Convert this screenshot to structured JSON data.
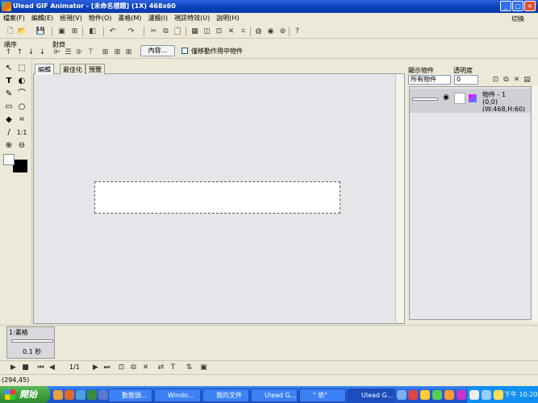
{
  "window": {
    "title": "Ulead GIF Animator - [未命名標題] (1X) 468x60",
    "min": "_",
    "max": "□",
    "close": "×"
  },
  "menu": {
    "items": [
      "檔案(F)",
      "編輯(E)",
      "檢視(V)",
      "物件(O)",
      "畫格(M)",
      "濾鏡(I)",
      "視訊特效(U)",
      "說明(H)"
    ],
    "switch_label": "切換"
  },
  "toolbar2": {
    "order_label": "順序",
    "align_label": "對齊",
    "content_button": "內容...",
    "move_checkbox": "僅移動作用中物件"
  },
  "tabs": [
    "編輯",
    "最佳化",
    "預覽"
  ],
  "right_panel": {
    "show_objects_label": "顯示物件",
    "opacity_label": "透明度",
    "filter_value": "所有物件",
    "opacity_value": "0",
    "object_name": "物件 - 1",
    "object_info": "(0,0)(W:468,H:60)"
  },
  "frames": {
    "frame_label": "1:畫格",
    "delay": "0.1 秒",
    "counter": "1/1"
  },
  "status": {
    "coords": "(294,45)"
  },
  "taskbar": {
    "start": "開始",
    "tasks": [
      "動態頭...",
      "Windo...",
      "我的文件",
      "Ulead G...",
      "\" 依\"",
      "Ulead G..."
    ],
    "clock": "下午 10:20"
  }
}
